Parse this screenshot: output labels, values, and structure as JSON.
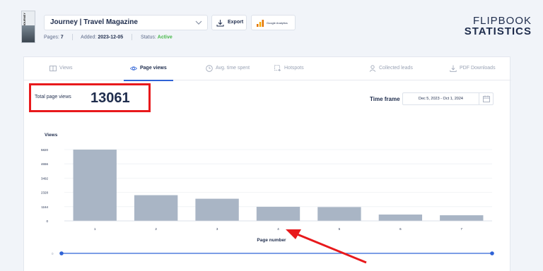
{
  "header": {
    "cover_text": "JOURNEY",
    "publication_title": "Journey | Travel Magazine",
    "export_label": "Export",
    "ga_label": "Google Analytics",
    "pages_label": "Pages:",
    "pages_value": "7",
    "added_label": "Added:",
    "added_value": "2023-12-05",
    "status_label": "Status:",
    "status_value": "Active",
    "brand_line1": "FLIPBOOK",
    "brand_line2": "STATISTICS"
  },
  "tabs": [
    {
      "label": "Views",
      "icon": "book-icon",
      "active": false
    },
    {
      "label": "Page views",
      "icon": "eye-icon",
      "active": true
    },
    {
      "label": "Avg. time spent",
      "icon": "clock-icon",
      "active": false
    },
    {
      "label": "Hotspots",
      "icon": "cursor-icon",
      "active": false
    },
    {
      "label": "Collected leads",
      "icon": "user-icon",
      "active": false
    },
    {
      "label": "PDF Downloads",
      "icon": "download-icon",
      "active": false
    }
  ],
  "summary": {
    "total_label": "Total page views",
    "total_value": "13061",
    "timeframe_label": "Time frame",
    "timeframe_value": "Dec 5, 2023 - Oct 1, 2024"
  },
  "colors": {
    "bar": "#a9b5c5",
    "accent": "#2f63d6",
    "highlight": "#e8191c",
    "status_active": "#47b84b"
  },
  "chart_data": {
    "type": "bar",
    "ylabel": "Views",
    "xlabel": "Page number",
    "y_ticks": [
      "0",
      "1164",
      "2328",
      "3492",
      "4656",
      "5820"
    ],
    "ylim": [
      0,
      5820
    ],
    "categories": [
      "1",
      "2",
      "3",
      "4",
      "5",
      "6",
      "7"
    ],
    "values": [
      5820,
      2100,
      1810,
      1150,
      1130,
      520,
      460
    ],
    "slider_label": "0"
  }
}
